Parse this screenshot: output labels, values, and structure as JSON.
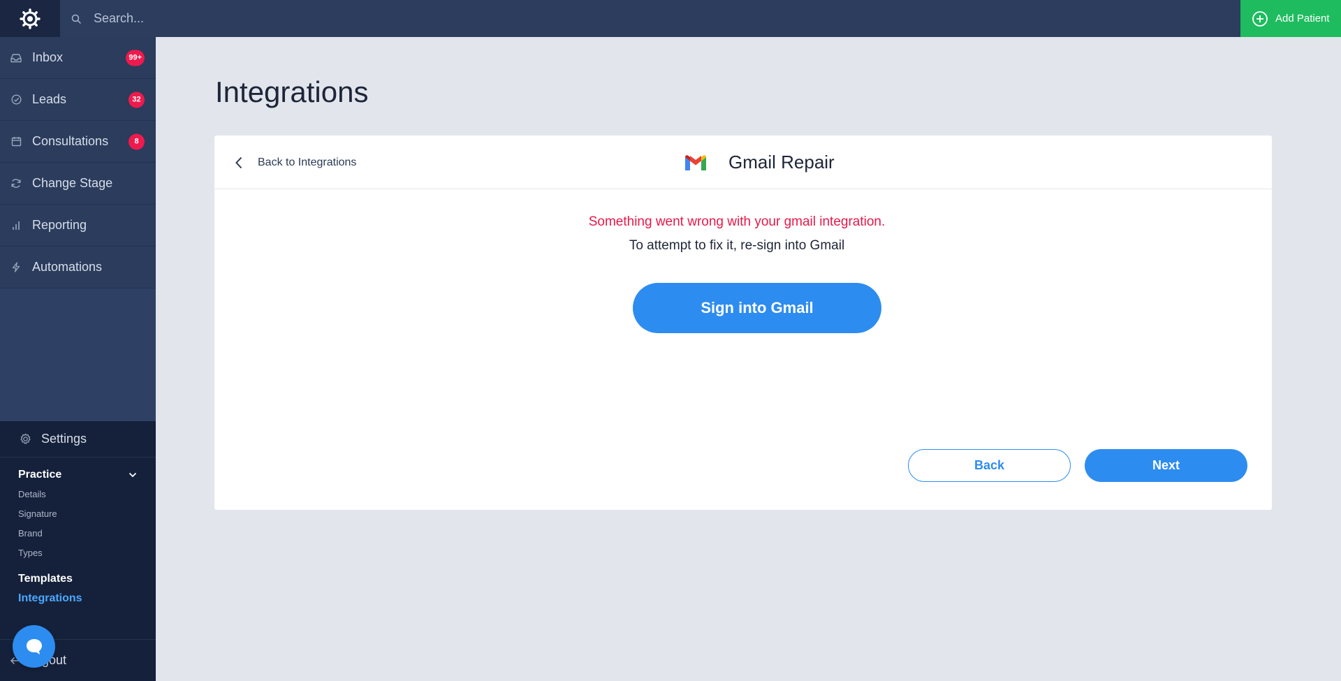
{
  "topbar": {
    "search_placeholder": "Search...",
    "add_patient_label": "Add Patient",
    "logo_icon": "gear-logo-icon",
    "accent_color": "#1ebc5f"
  },
  "sidebar": {
    "items": [
      {
        "label": "Inbox",
        "icon": "inbox-icon",
        "badge": "99+"
      },
      {
        "label": "Leads",
        "icon": "check-circle-icon",
        "badge": "32"
      },
      {
        "label": "Consultations",
        "icon": "calendar-icon",
        "badge": "8"
      },
      {
        "label": "Change Stage",
        "icon": "refresh-icon"
      },
      {
        "label": "Reporting",
        "icon": "bar-chart-icon"
      },
      {
        "label": "Automations",
        "icon": "lightning-icon"
      }
    ],
    "settings": {
      "label": "Settings",
      "practice": {
        "label": "Practice",
        "items": [
          "Details",
          "Signature",
          "Brand",
          "Types"
        ]
      },
      "templates_label": "Templates",
      "integrations_label": "Integrations"
    },
    "logout_label": "Logout",
    "badge_color": "#ee1a4d"
  },
  "main": {
    "page_title": "Integrations",
    "card": {
      "back_label": "Back to Integrations",
      "title": "Gmail Repair",
      "error_message": "Something went wrong with your gmail integration.",
      "fix_message": "To attempt to fix it, re-sign into Gmail",
      "sign_in_label": "Sign into Gmail",
      "back_button": "Back",
      "next_button": "Next"
    },
    "primary_color": "#2d8cf0",
    "error_color": "#e8184a"
  }
}
